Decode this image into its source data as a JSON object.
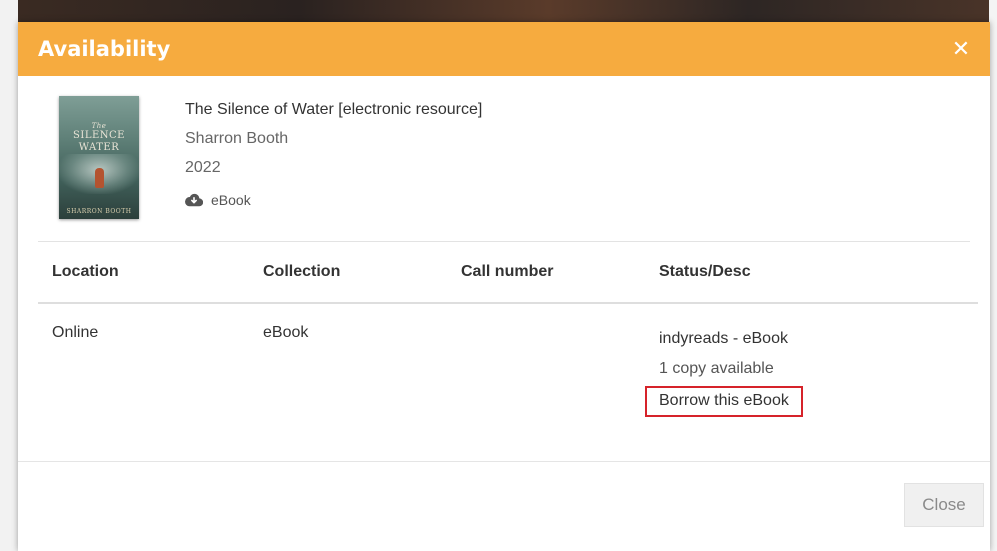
{
  "modal": {
    "title": "Availability",
    "close_icon": "close-icon",
    "accent_color": "#f6ab3f"
  },
  "item": {
    "cover": {
      "line1": "The",
      "line2": "SILENCE",
      "line3": "WATER",
      "line4": "SHARRON BOOTH"
    },
    "title": "The Silence of Water [electronic resource]",
    "author": "Sharron Booth",
    "year": "2022",
    "format_icon": "cloud-download-icon",
    "format": "eBook"
  },
  "table": {
    "headers": [
      "Location",
      "Collection",
      "Call number",
      "Status/Desc"
    ],
    "rows": [
      {
        "location": "Online",
        "collection": "eBook",
        "call_number": "",
        "status": "indyreads - eBook",
        "copies": "1 copy available",
        "action": "Borrow this eBook"
      }
    ]
  },
  "footer": {
    "close_label": "Close"
  },
  "highlight_color": "#d6232a"
}
